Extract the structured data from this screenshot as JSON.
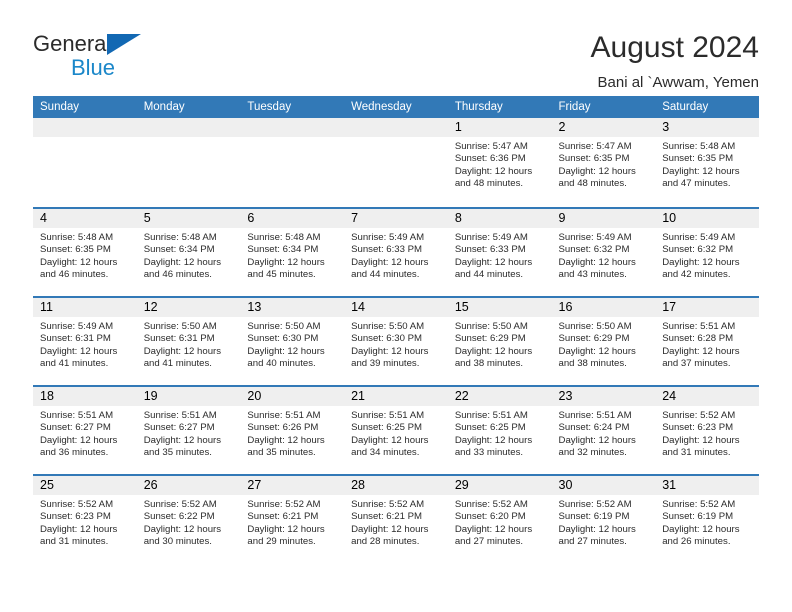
{
  "brand": {
    "name_part1": "General",
    "name_part2": "Blue",
    "triangle_color": "#1268b3",
    "blue_color": "#1b87c9"
  },
  "header": {
    "title": "August 2024",
    "subtitle": "Bani al `Awwam, Yemen"
  },
  "theme": {
    "header_blue": "#3279b7",
    "daynum_band": "#efefef",
    "text": "#2b2b2b"
  },
  "calendar": {
    "weekday_headers": [
      "Sunday",
      "Monday",
      "Tuesday",
      "Wednesday",
      "Thursday",
      "Friday",
      "Saturday"
    ],
    "labels": {
      "sunrise_prefix": "Sunrise:",
      "sunset_prefix": "Sunset:",
      "daylight_prefix": "Daylight:"
    },
    "weeks": [
      [
        {
          "day": "",
          "sunrise": "",
          "sunset": "",
          "daylight": "",
          "empty": true
        },
        {
          "day": "",
          "sunrise": "",
          "sunset": "",
          "daylight": "",
          "empty": true
        },
        {
          "day": "",
          "sunrise": "",
          "sunset": "",
          "daylight": "",
          "empty": true
        },
        {
          "day": "",
          "sunrise": "",
          "sunset": "",
          "daylight": "",
          "empty": true
        },
        {
          "day": "1",
          "sunrise": "Sunrise: 5:47 AM",
          "sunset": "Sunset: 6:36 PM",
          "daylight": "Daylight: 12 hours and 48 minutes."
        },
        {
          "day": "2",
          "sunrise": "Sunrise: 5:47 AM",
          "sunset": "Sunset: 6:35 PM",
          "daylight": "Daylight: 12 hours and 48 minutes."
        },
        {
          "day": "3",
          "sunrise": "Sunrise: 5:48 AM",
          "sunset": "Sunset: 6:35 PM",
          "daylight": "Daylight: 12 hours and 47 minutes."
        }
      ],
      [
        {
          "day": "4",
          "sunrise": "Sunrise: 5:48 AM",
          "sunset": "Sunset: 6:35 PM",
          "daylight": "Daylight: 12 hours and 46 minutes."
        },
        {
          "day": "5",
          "sunrise": "Sunrise: 5:48 AM",
          "sunset": "Sunset: 6:34 PM",
          "daylight": "Daylight: 12 hours and 46 minutes."
        },
        {
          "day": "6",
          "sunrise": "Sunrise: 5:48 AM",
          "sunset": "Sunset: 6:34 PM",
          "daylight": "Daylight: 12 hours and 45 minutes."
        },
        {
          "day": "7",
          "sunrise": "Sunrise: 5:49 AM",
          "sunset": "Sunset: 6:33 PM",
          "daylight": "Daylight: 12 hours and 44 minutes."
        },
        {
          "day": "8",
          "sunrise": "Sunrise: 5:49 AM",
          "sunset": "Sunset: 6:33 PM",
          "daylight": "Daylight: 12 hours and 44 minutes."
        },
        {
          "day": "9",
          "sunrise": "Sunrise: 5:49 AM",
          "sunset": "Sunset: 6:32 PM",
          "daylight": "Daylight: 12 hours and 43 minutes."
        },
        {
          "day": "10",
          "sunrise": "Sunrise: 5:49 AM",
          "sunset": "Sunset: 6:32 PM",
          "daylight": "Daylight: 12 hours and 42 minutes."
        }
      ],
      [
        {
          "day": "11",
          "sunrise": "Sunrise: 5:49 AM",
          "sunset": "Sunset: 6:31 PM",
          "daylight": "Daylight: 12 hours and 41 minutes."
        },
        {
          "day": "12",
          "sunrise": "Sunrise: 5:50 AM",
          "sunset": "Sunset: 6:31 PM",
          "daylight": "Daylight: 12 hours and 41 minutes."
        },
        {
          "day": "13",
          "sunrise": "Sunrise: 5:50 AM",
          "sunset": "Sunset: 6:30 PM",
          "daylight": "Daylight: 12 hours and 40 minutes."
        },
        {
          "day": "14",
          "sunrise": "Sunrise: 5:50 AM",
          "sunset": "Sunset: 6:30 PM",
          "daylight": "Daylight: 12 hours and 39 minutes."
        },
        {
          "day": "15",
          "sunrise": "Sunrise: 5:50 AM",
          "sunset": "Sunset: 6:29 PM",
          "daylight": "Daylight: 12 hours and 38 minutes."
        },
        {
          "day": "16",
          "sunrise": "Sunrise: 5:50 AM",
          "sunset": "Sunset: 6:29 PM",
          "daylight": "Daylight: 12 hours and 38 minutes."
        },
        {
          "day": "17",
          "sunrise": "Sunrise: 5:51 AM",
          "sunset": "Sunset: 6:28 PM",
          "daylight": "Daylight: 12 hours and 37 minutes."
        }
      ],
      [
        {
          "day": "18",
          "sunrise": "Sunrise: 5:51 AM",
          "sunset": "Sunset: 6:27 PM",
          "daylight": "Daylight: 12 hours and 36 minutes."
        },
        {
          "day": "19",
          "sunrise": "Sunrise: 5:51 AM",
          "sunset": "Sunset: 6:27 PM",
          "daylight": "Daylight: 12 hours and 35 minutes."
        },
        {
          "day": "20",
          "sunrise": "Sunrise: 5:51 AM",
          "sunset": "Sunset: 6:26 PM",
          "daylight": "Daylight: 12 hours and 35 minutes."
        },
        {
          "day": "21",
          "sunrise": "Sunrise: 5:51 AM",
          "sunset": "Sunset: 6:25 PM",
          "daylight": "Daylight: 12 hours and 34 minutes."
        },
        {
          "day": "22",
          "sunrise": "Sunrise: 5:51 AM",
          "sunset": "Sunset: 6:25 PM",
          "daylight": "Daylight: 12 hours and 33 minutes."
        },
        {
          "day": "23",
          "sunrise": "Sunrise: 5:51 AM",
          "sunset": "Sunset: 6:24 PM",
          "daylight": "Daylight: 12 hours and 32 minutes."
        },
        {
          "day": "24",
          "sunrise": "Sunrise: 5:52 AM",
          "sunset": "Sunset: 6:23 PM",
          "daylight": "Daylight: 12 hours and 31 minutes."
        }
      ],
      [
        {
          "day": "25",
          "sunrise": "Sunrise: 5:52 AM",
          "sunset": "Sunset: 6:23 PM",
          "daylight": "Daylight: 12 hours and 31 minutes."
        },
        {
          "day": "26",
          "sunrise": "Sunrise: 5:52 AM",
          "sunset": "Sunset: 6:22 PM",
          "daylight": "Daylight: 12 hours and 30 minutes."
        },
        {
          "day": "27",
          "sunrise": "Sunrise: 5:52 AM",
          "sunset": "Sunset: 6:21 PM",
          "daylight": "Daylight: 12 hours and 29 minutes."
        },
        {
          "day": "28",
          "sunrise": "Sunrise: 5:52 AM",
          "sunset": "Sunset: 6:21 PM",
          "daylight": "Daylight: 12 hours and 28 minutes."
        },
        {
          "day": "29",
          "sunrise": "Sunrise: 5:52 AM",
          "sunset": "Sunset: 6:20 PM",
          "daylight": "Daylight: 12 hours and 27 minutes."
        },
        {
          "day": "30",
          "sunrise": "Sunrise: 5:52 AM",
          "sunset": "Sunset: 6:19 PM",
          "daylight": "Daylight: 12 hours and 27 minutes."
        },
        {
          "day": "31",
          "sunrise": "Sunrise: 5:52 AM",
          "sunset": "Sunset: 6:19 PM",
          "daylight": "Daylight: 12 hours and 26 minutes."
        }
      ]
    ]
  }
}
